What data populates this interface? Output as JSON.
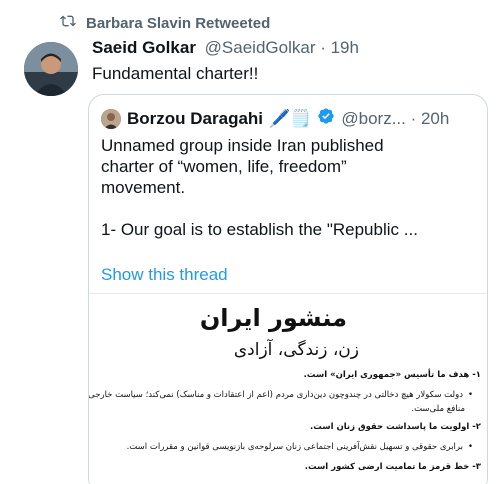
{
  "retweet": {
    "icon": "retweet-icon",
    "label": "Barbara Slavin Retweeted"
  },
  "tweet": {
    "name": "Saeid Golkar",
    "handle": "@SaeidGolkar · 19h",
    "text": "Fundamental charter!!"
  },
  "quote": {
    "name": "Borzou Daragahi",
    "name_emojis": "🖊️🗒️",
    "verified_icon": "verified-badge-icon",
    "handle": "@borz... · 20h",
    "text_line1": "Unnamed group inside Iran published",
    "text_line2": "charter of “women, life, freedom”",
    "text_line3": "movement.",
    "text_line4": "1- Our goal is to establish the \"Republic ...",
    "show_thread": "Show this thread"
  },
  "document": {
    "title": "منشور ایران",
    "subtitle": "زن، زندگی، آزادی",
    "lines": [
      "۱- هدف ما تأسیس «جمهوری ایران» است.",
      "دولت سکولار هیچ دخالتی در چندوچون دین‌داری مردم (اعم از اعتقادات و مناسک) نمی‌کند؛ سیاست خارجی مبتنی بر",
      "منافع ملی‌ست.",
      "۲- اولویت ما پاسداشت حقوق زنان است.",
      "برابری حقوقی و تسهیل نقش‌آفرینی اجتماعی زنان سرلوحه‌ی بازنویسی قوانین و مقررات است.",
      "۳- خط قرمز ما تمامیت ارضی کشور است."
    ]
  },
  "colors": {
    "link": "#1d9bf0",
    "secondary": "#536471",
    "verified": "#1d9bf0"
  }
}
